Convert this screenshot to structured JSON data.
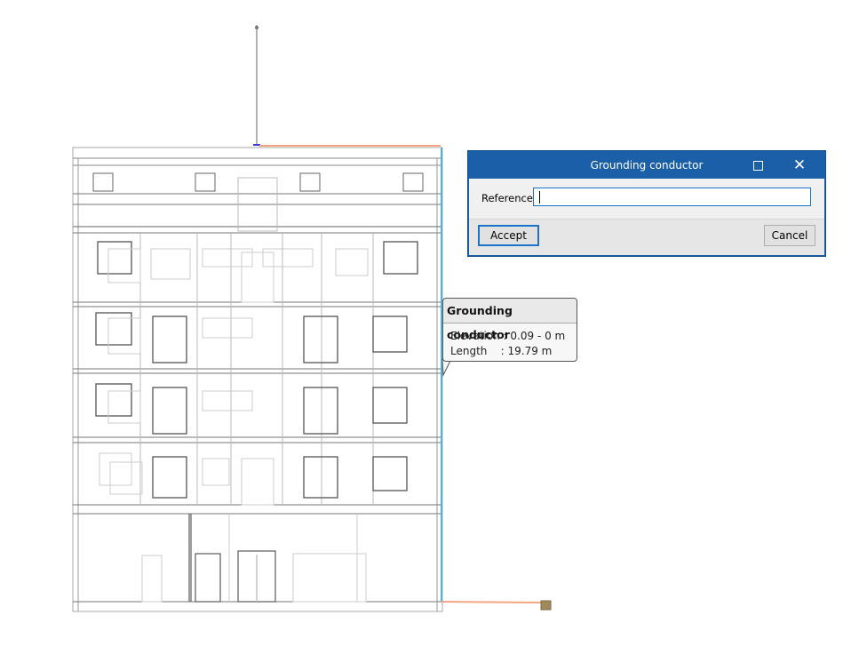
{
  "dialog": {
    "title": "Grounding conductor",
    "reference_label": "Reference",
    "reference_value": "",
    "accept_label": "Accept",
    "cancel_label": "Cancel",
    "close_glyph": "✕"
  },
  "tooltip": {
    "title": "Grounding conductor",
    "elevation": "Elevation : 0.09 - 0 m",
    "length": "Length    : 19.79 m"
  },
  "colors": {
    "conductor": "#f4a582",
    "downlead": "#4fb3d9",
    "titlebar": "#1a5fa8"
  }
}
